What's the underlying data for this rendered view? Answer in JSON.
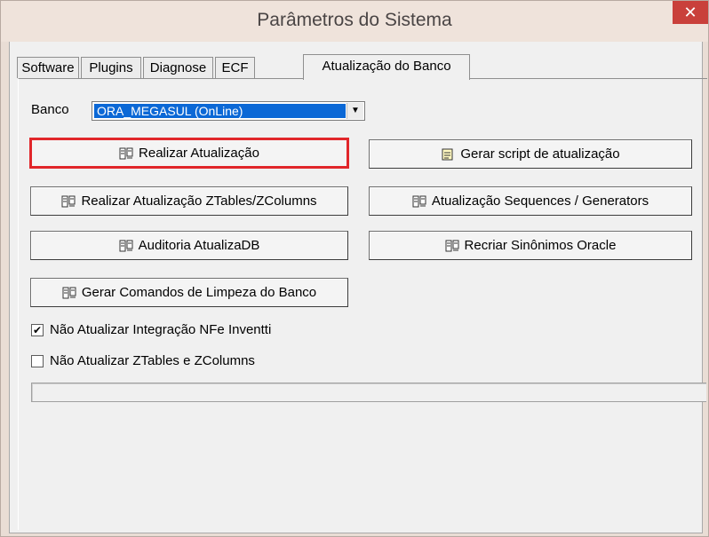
{
  "window": {
    "title": "Parâmetros do Sistema",
    "close_glyph": "✕"
  },
  "tabs": [
    {
      "label": "Software",
      "active": false
    },
    {
      "label": "Plugins",
      "active": false
    },
    {
      "label": "Diagnose",
      "active": false
    },
    {
      "label": "ECF",
      "active": false
    },
    {
      "label": "Atualização do Banco",
      "active": true
    }
  ],
  "banco": {
    "label": "Banco",
    "selected": "ORA_MEGASUL (OnLine)",
    "arrow": "▼"
  },
  "buttons": {
    "realizar": "Realizar Atualização",
    "gerar_script": "Gerar script de atualização",
    "realizar_ztables": "Realizar Atualização ZTables/ZColumns",
    "sequences": "Atualização Sequences / Generators",
    "auditoria": "Auditoria AtualizaDB",
    "sinonimos": "Recriar Sinônimos Oracle",
    "limpeza": "Gerar Comandos de Limpeza do Banco"
  },
  "checkboxes": [
    {
      "label": "Não Atualizar Integração NFe Inventti",
      "checked": true,
      "mark": "✔"
    },
    {
      "label": "Não Atualizar ZTables e ZColumns",
      "checked": false,
      "mark": ""
    }
  ],
  "progress": {
    "value": 0
  },
  "colors": {
    "highlight": "#e1262a",
    "selection": "#0b68d6",
    "close": "#c9403b"
  },
  "icons": {
    "server": "server-icon",
    "script": "script-icon"
  }
}
